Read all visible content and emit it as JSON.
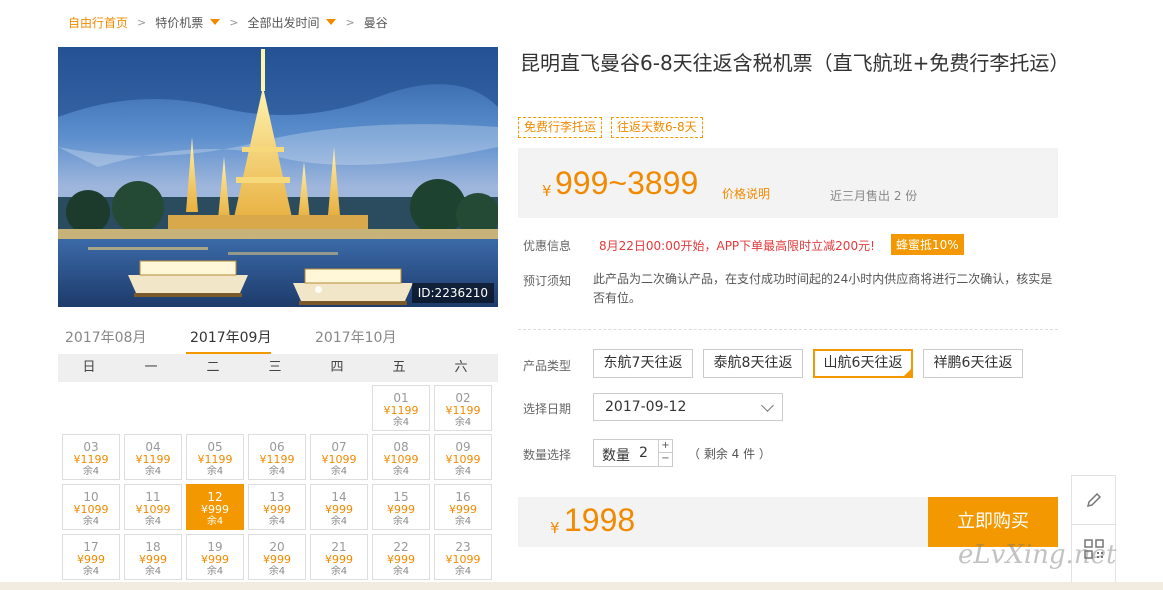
{
  "breadcrumb": {
    "home": "自由行首页",
    "category": "特价机票",
    "departure": "全部出发时间",
    "destination": "曼谷",
    "separator": ">"
  },
  "hero": {
    "image_id": "ID:2236210"
  },
  "product": {
    "title": "昆明直飞曼谷6-8天往返含税机票（直飞航班+免费行李托运）",
    "tags": [
      "免费行李托运",
      "往返天数6-8天"
    ]
  },
  "price": {
    "currency": "¥",
    "range": "999~3899",
    "note_link": "价格说明",
    "sold": "近三月售出 2 份"
  },
  "offers": {
    "label": "优惠信息",
    "text": "8月22日00:00开始，APP下单最高限时立减200元!",
    "badge": "蜂蜜抵10%"
  },
  "booking_notice": {
    "label": "预订须知",
    "text": "此产品为二次确认产品，在支付成功时间起的24小时内供应商将进行二次确认，核实是否有位。"
  },
  "product_type": {
    "label": "产品类型",
    "options": [
      "东航7天往返",
      "泰航8天往返",
      "山航6天往返",
      "祥鹏6天往返"
    ],
    "selected_index": 2
  },
  "date_select": {
    "label": "选择日期",
    "value": "2017-09-12"
  },
  "quantity": {
    "label": "数量选择",
    "field_label": "数量",
    "value": "2",
    "plus": "+",
    "minus": "−",
    "remaining": "（ 剩余 4 件 ）"
  },
  "total": {
    "currency": "¥",
    "amount": "1998",
    "buy_label": "立即购买"
  },
  "calendar": {
    "months": [
      "2017年08月",
      "2017年09月",
      "2017年10月"
    ],
    "active_month": 1,
    "weekdays": [
      "日",
      "一",
      "二",
      "三",
      "四",
      "五",
      "六"
    ],
    "rows": [
      [
        null,
        null,
        null,
        null,
        null,
        {
          "day": "01",
          "price": "¥1199",
          "remain": "余4"
        },
        {
          "day": "02",
          "price": "¥1199",
          "remain": "余4"
        }
      ],
      [
        {
          "day": "03",
          "price": "¥1199",
          "remain": "余4"
        },
        {
          "day": "04",
          "price": "¥1199",
          "remain": "余4"
        },
        {
          "day": "05",
          "price": "¥1199",
          "remain": "余4"
        },
        {
          "day": "06",
          "price": "¥1199",
          "remain": "余4"
        },
        {
          "day": "07",
          "price": "¥1099",
          "remain": "余4"
        },
        {
          "day": "08",
          "price": "¥1099",
          "remain": "余4"
        },
        {
          "day": "09",
          "price": "¥1099",
          "remain": "余4"
        }
      ],
      [
        {
          "day": "10",
          "price": "¥1099",
          "remain": "余4"
        },
        {
          "day": "11",
          "price": "¥1099",
          "remain": "余4"
        },
        {
          "day": "12",
          "price": "¥999",
          "remain": "余4",
          "selected": true
        },
        {
          "day": "13",
          "price": "¥999",
          "remain": "余4"
        },
        {
          "day": "14",
          "price": "¥999",
          "remain": "余4"
        },
        {
          "day": "15",
          "price": "¥999",
          "remain": "余4"
        },
        {
          "day": "16",
          "price": "¥999",
          "remain": "余4"
        }
      ],
      [
        {
          "day": "17",
          "price": "¥999",
          "remain": "余4"
        },
        {
          "day": "18",
          "price": "¥999",
          "remain": "余4"
        },
        {
          "day": "19",
          "price": "¥999",
          "remain": "余4"
        },
        {
          "day": "20",
          "price": "¥999",
          "remain": "余4"
        },
        {
          "day": "21",
          "price": "¥999",
          "remain": "余4"
        },
        {
          "day": "22",
          "price": "¥999",
          "remain": "余4"
        },
        {
          "day": "23",
          "price": "¥1099",
          "remain": "余4"
        }
      ]
    ]
  },
  "watermark": "eLvXing.net",
  "colors": {
    "accent": "#f39800",
    "price": "#f08a00",
    "promo": "#e4393c"
  }
}
